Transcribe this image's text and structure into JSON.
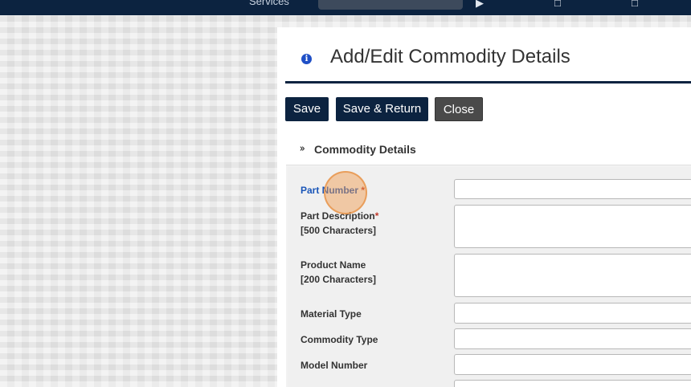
{
  "topbar": {
    "nav_fragment": "Services",
    "icon_fragments": [
      "…",
      "⌘",
      "☰"
    ]
  },
  "page": {
    "title": "Add/Edit Commodity Details"
  },
  "toolbar": {
    "save_label": "Save",
    "save_return_label": "Save & Return",
    "close_label": "Close"
  },
  "section": {
    "title": "Commodity Details",
    "toggle_icon": "double-chevron-down"
  },
  "form": {
    "required_mark": "*",
    "fields": [
      {
        "label": "Part Number",
        "required": true,
        "value": ""
      },
      {
        "label": "Part Description",
        "sublabel": "[500 Characters]",
        "required": true,
        "value": ""
      },
      {
        "label": "Product Name",
        "sublabel": "[200 Characters]",
        "required": false,
        "value": ""
      },
      {
        "label": "Material Type",
        "required": false,
        "value": ""
      },
      {
        "label": "Commodity Type",
        "required": false,
        "value": ""
      },
      {
        "label": "Model Number",
        "required": false,
        "value": ""
      }
    ]
  },
  "colors": {
    "navy": "#0c2340",
    "link_blue": "#1a56b8",
    "required_red": "#c0392b",
    "close_gray": "#4a4a4a"
  }
}
